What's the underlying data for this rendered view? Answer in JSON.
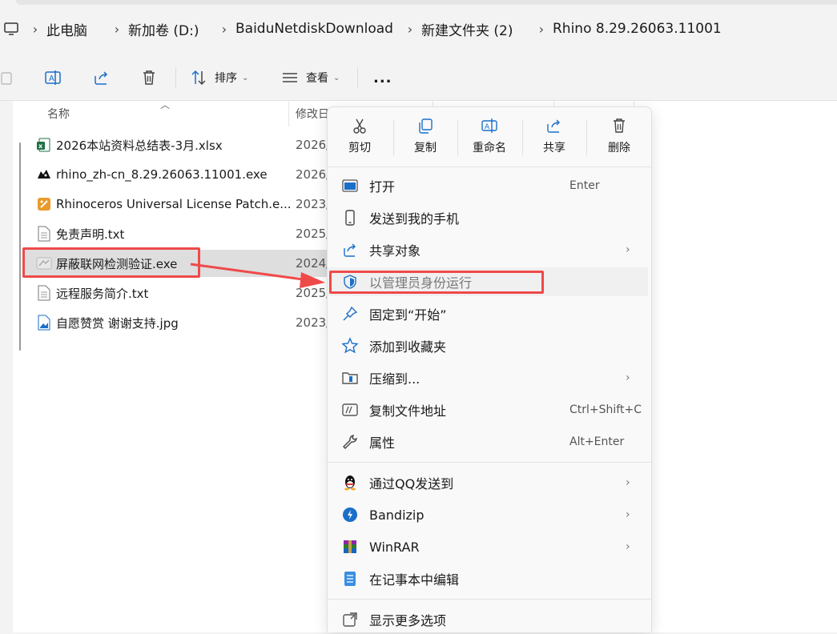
{
  "breadcrumb": [
    "此电脑",
    "新加卷 (D:)",
    "BaiduNetdiskDownload",
    "新建文件夹 (2)",
    "Rhino 8.29.26063.11001"
  ],
  "toolbar": {
    "sort_label": "排序",
    "view_label": "查看",
    "more_label": "..."
  },
  "columns": {
    "name": "名称",
    "modified": "修改日"
  },
  "files": [
    {
      "name": "2026本站资料总结表-3月.xlsx",
      "date": "2026/",
      "icon": "excel-icon"
    },
    {
      "name": "rhino_zh-cn_8.29.26063.11001.exe",
      "date": "2026/",
      "icon": "rhino-icon"
    },
    {
      "name": "Rhinoceros Universal License Patch.e...",
      "date": "2023/",
      "icon": "patch-icon"
    },
    {
      "name": "免责声明.txt",
      "date": "2025/",
      "icon": "text-file-icon"
    },
    {
      "name": "屏蔽联网检测验证.exe",
      "date": "2024/",
      "icon": "exe-icon"
    },
    {
      "name": "远程服务简介.txt",
      "date": "2025/",
      "icon": "text-file-icon"
    },
    {
      "name": "自愿赞赏 谢谢支持.jpg",
      "date": "2023/",
      "icon": "image-file-icon"
    }
  ],
  "context_menu": {
    "quick_actions": [
      {
        "label": "剪切",
        "icon": "scissors-icon"
      },
      {
        "label": "复制",
        "icon": "copy-icon"
      },
      {
        "label": "重命名",
        "icon": "rename-icon"
      },
      {
        "label": "共享",
        "icon": "share-icon"
      },
      {
        "label": "删除",
        "icon": "trash-icon"
      }
    ],
    "items": [
      {
        "label": "打开",
        "shortcut": "Enter",
        "icon": "open-icon"
      },
      {
        "label": "发送到我的手机",
        "icon": "phone-icon"
      },
      {
        "label": "共享对象",
        "icon": "share-icon",
        "submenu": true
      },
      {
        "label": "以管理员身份运行",
        "icon": "shield-icon"
      },
      {
        "label": "固定到“开始”",
        "icon": "pin-icon"
      },
      {
        "label": "添加到收藏夹",
        "icon": "star-icon"
      },
      {
        "label": "压缩到...",
        "icon": "zip-folder-icon",
        "submenu": true
      },
      {
        "label": "复制文件地址",
        "shortcut": "Ctrl+Shift+C",
        "icon": "copy-path-icon"
      },
      {
        "label": "属性",
        "shortcut": "Alt+Enter",
        "icon": "wrench-icon"
      },
      {
        "label": "通过QQ发送到",
        "icon": "qq-icon",
        "submenu": true
      },
      {
        "label": "Bandizip",
        "icon": "bandizip-icon",
        "submenu": true
      },
      {
        "label": "WinRAR",
        "icon": "winrar-icon",
        "submenu": true
      },
      {
        "label": "在记事本中编辑",
        "icon": "notepad-icon"
      },
      {
        "label": "显示更多选项",
        "icon": "more-options-icon"
      }
    ]
  },
  "colors": {
    "highlight_red": "#ef4a4a",
    "accent_blue": "#1a6fc9",
    "selection_bg": "#dedede"
  }
}
